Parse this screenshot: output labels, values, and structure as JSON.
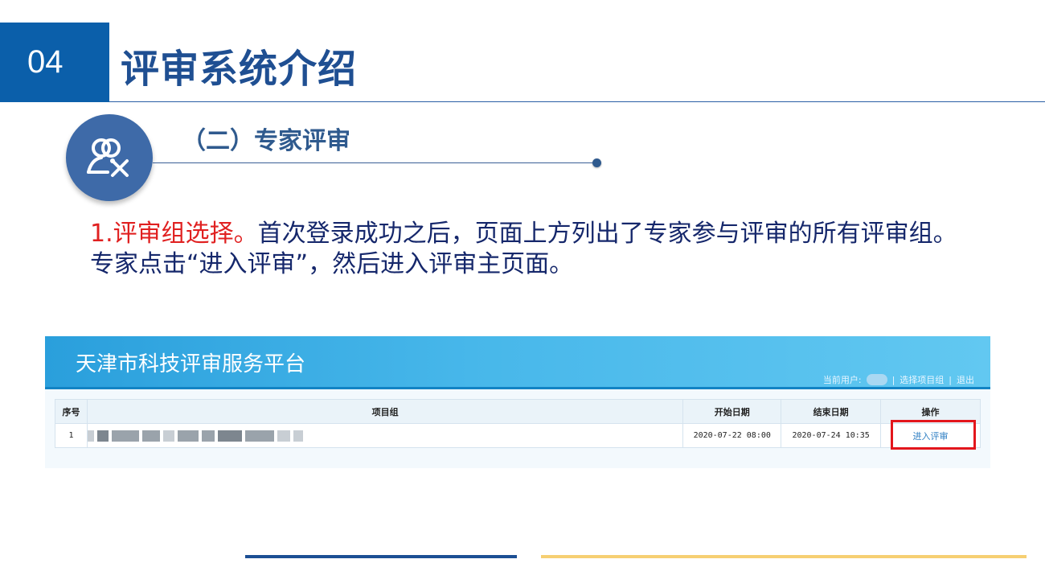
{
  "slide": {
    "number": "04",
    "title": "评审系统介绍",
    "subtitle": "（二）专家评审",
    "paragraph_lead": "1.评审组选择。",
    "paragraph_rest": "首次登录成功之后，页面上方列出了专家参与评审的所有评审组。专家点击“进入评审”，然后进入评审主页面。",
    "colors": {
      "accent_blue": "#0b5faa",
      "title_blue": "#1f4f92",
      "highlight_red": "#e02020",
      "bottom_yellow": "#f6cf72"
    }
  },
  "screenshot": {
    "platform_title": "天津市科技评审服务平台",
    "current_user_label": "当前用户:",
    "select_group_link": "选择项目组",
    "logout_link": "退出",
    "separator": "|",
    "table": {
      "headers": [
        "序号",
        "项目组",
        "开始日期",
        "结束日期",
        "操作"
      ],
      "rows": [
        {
          "index": "1",
          "group": "",
          "start": "2020-07-22 08:00",
          "end": "2020-07-24 10:35",
          "action": "进入评审"
        }
      ]
    }
  },
  "icons": {
    "section_icon": "expert-tools-icon"
  }
}
